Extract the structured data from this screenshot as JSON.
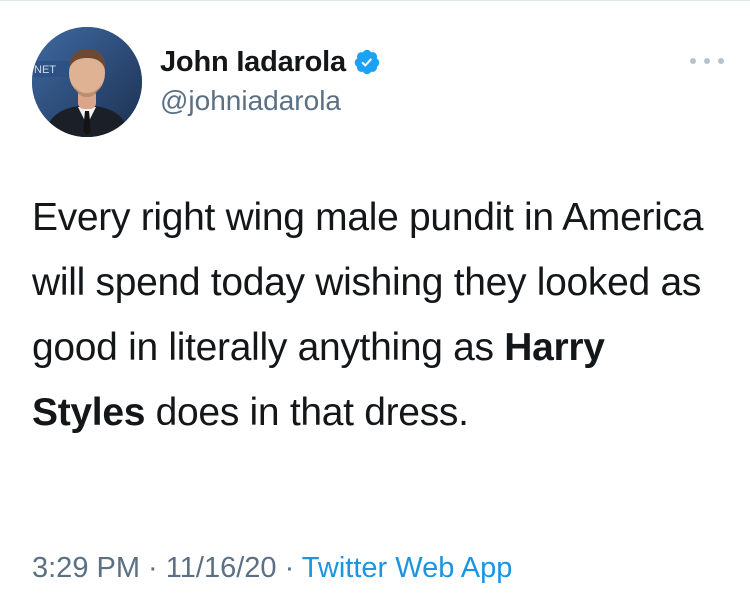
{
  "author": {
    "display_name": "John Iadarola",
    "handle": "@johniadarola",
    "avatar_icon": "profile-photo",
    "verified_icon": "verified-badge-icon",
    "avatar_caption": "NET"
  },
  "tweet": {
    "text_before": "Every right wing male pundit in America will spend today wishing they looked as good in literally anything as ",
    "text_bold": "Harry Styles",
    "text_after": " does in that dress."
  },
  "meta": {
    "time": "3:29 PM",
    "separator_1": " · ",
    "date": "11/16/20",
    "separator_2": " · ",
    "source": "Twitter Web App"
  },
  "colors": {
    "name": "#14171a",
    "secondary": "#5b7083",
    "link": "#1b95e0",
    "verified": "#1da1f2"
  }
}
